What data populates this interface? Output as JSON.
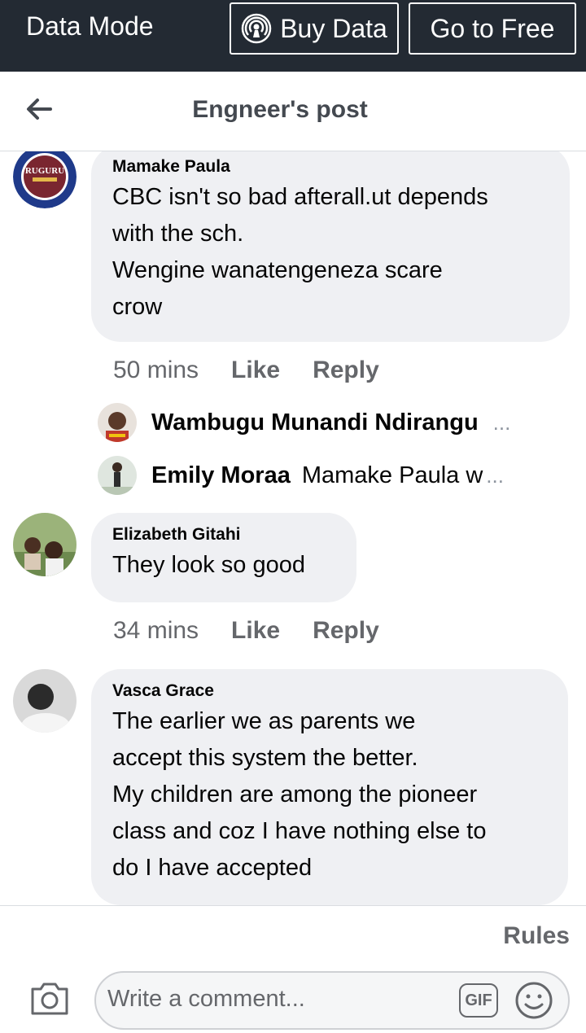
{
  "status": {
    "mode_label": "Data Mode",
    "buy_data_label": "Buy Data",
    "go_free_label": "Go to Free"
  },
  "header": {
    "title": "Engneer's post"
  },
  "comments": [
    {
      "author": "Mamake Paula",
      "lines": [
        "CBC isn't so bad afterall.ut depends",
        "with the sch.",
        "Wengine wanatengeneza scare",
        "crow"
      ],
      "time": "50 mins",
      "like": "Like",
      "reply": "Reply",
      "avatar_text": "RUGURU",
      "replies": [
        {
          "author": "Wambugu Munandi Ndirangu",
          "text": "",
          "ellipsis": "..."
        },
        {
          "author": "Emily Moraa",
          "text": "Mamake Paula w",
          "ellipsis": "..."
        }
      ]
    },
    {
      "author": "Elizabeth Gitahi",
      "lines": [
        "They look so good"
      ],
      "time": "34 mins",
      "like": "Like",
      "reply": "Reply"
    },
    {
      "author": "Vasca Grace",
      "lines": [
        "The earlier we as parents we",
        "accept this system the better.",
        "My children are among the pioneer",
        "class and coz I have nothing else to",
        "do I have accepted"
      ]
    }
  ],
  "composer": {
    "rules_label": "Rules",
    "placeholder": "Write a comment...",
    "gif_label": "GIF"
  },
  "icons": [
    "back-arrow-icon",
    "broadcast-icon",
    "camera-icon",
    "gif-icon",
    "emoji-icon"
  ],
  "colors": {
    "topbar": "#232a33",
    "bubble": "#eff0f3",
    "muted": "#65676b"
  }
}
